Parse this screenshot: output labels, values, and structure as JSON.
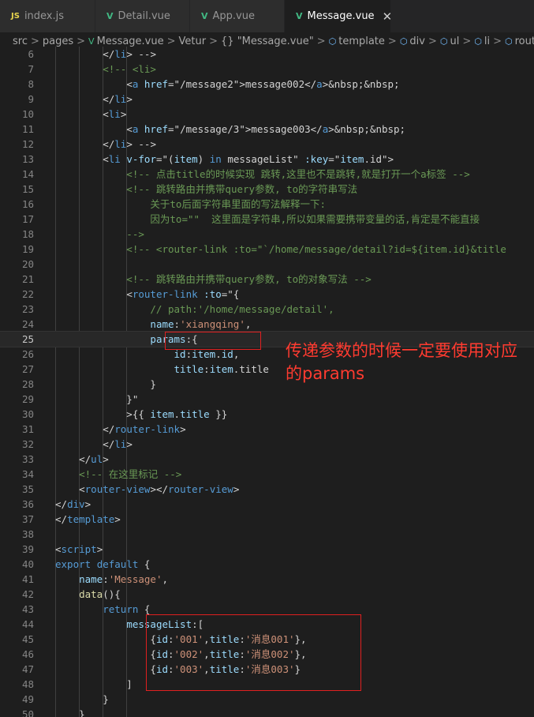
{
  "tabs": [
    {
      "icon": "JS",
      "label": "index.js",
      "active": false
    },
    {
      "icon": "V",
      "label": "Detail.vue",
      "active": false
    },
    {
      "icon": "V",
      "label": "App.vue",
      "active": false
    },
    {
      "icon": "V",
      "label": "Message.vue",
      "active": true,
      "close": "✕"
    }
  ],
  "breadcrumb": {
    "items": [
      "src",
      "pages",
      "Message.vue",
      "Vetur",
      "{} \"Message.vue\"",
      "template",
      "div",
      "ul",
      "li",
      "router-link"
    ],
    "separator": ">"
  },
  "editor": {
    "current_line": 25,
    "lines": [
      {
        "n": "6",
        "t": "            </li> -->"
      },
      {
        "n": "7",
        "t": "            <!-- <li>"
      },
      {
        "n": "8",
        "t": "                <a href=\"/message2\">message002</a>&nbsp;&nbsp;"
      },
      {
        "n": "9",
        "t": "            </li>"
      },
      {
        "n": "10",
        "t": "            <li>"
      },
      {
        "n": "11",
        "t": "                <a href=\"/message/3\">message003</a>&nbsp;&nbsp;"
      },
      {
        "n": "12",
        "t": "            </li> -->"
      },
      {
        "n": "13",
        "t": "            <li v-for=\"(item) in messageList\" :key=\"item.id\">"
      },
      {
        "n": "14",
        "t": "                <!-- 点击title的时候实现 跳转,这里也不是跳转,就是打开一个a标签 -->"
      },
      {
        "n": "15",
        "t": "                <!-- 跳转路由并携带query参数, to的字符串写法"
      },
      {
        "n": "16",
        "t": "                    关于to后面字符串里面的写法解释一下:"
      },
      {
        "n": "17",
        "t": "                    因为to=\"\"  这里面是字符串,所以如果需要携带变量的话,肯定是不能直接"
      },
      {
        "n": "18",
        "t": "                -->"
      },
      {
        "n": "19",
        "t": "                <!-- <router-link :to=\"`/home/message/detail?id=${item.id}&title"
      },
      {
        "n": "20",
        "t": ""
      },
      {
        "n": "21",
        "t": "                <!-- 跳转路由并携带query参数, to的对象写法 -->"
      },
      {
        "n": "22",
        "t": "                <router-link :to=\"{"
      },
      {
        "n": "23",
        "t": "                    // path:'/home/message/detail',"
      },
      {
        "n": "24",
        "t": "                    name:'xiangqing',"
      },
      {
        "n": "25",
        "t": "                    params:{"
      },
      {
        "n": "26",
        "t": "                        id:item.id,"
      },
      {
        "n": "27",
        "t": "                        title:item.title"
      },
      {
        "n": "28",
        "t": "                    }"
      },
      {
        "n": "29",
        "t": "                }\""
      },
      {
        "n": "30",
        "t": "                >{{ item.title }}"
      },
      {
        "n": "31",
        "t": "            </router-link>"
      },
      {
        "n": "32",
        "t": "            </li>"
      },
      {
        "n": "33",
        "t": "        </ul>"
      },
      {
        "n": "34",
        "t": "        <!-- 在这里标记 -->"
      },
      {
        "n": "35",
        "t": "        <router-view></router-view>"
      },
      {
        "n": "36",
        "t": "    </div>"
      },
      {
        "n": "37",
        "t": "</template>"
      },
      {
        "n": "38",
        "t": ""
      },
      {
        "n": "39",
        "t": "<script>"
      },
      {
        "n": "40",
        "t": "    export default {"
      },
      {
        "n": "41",
        "t": "        name:'Message',"
      },
      {
        "n": "42",
        "t": "        data(){"
      },
      {
        "n": "43",
        "t": "            return {"
      },
      {
        "n": "44",
        "t": "                messageList:["
      },
      {
        "n": "45",
        "t": "                    {id:'001',title:'消息001'},"
      },
      {
        "n": "46",
        "t": "                    {id:'002',title:'消息002'},"
      },
      {
        "n": "47",
        "t": "                    {id:'003',title:'消息003'}"
      },
      {
        "n": "48",
        "t": "                ]"
      },
      {
        "n": "49",
        "t": "            }"
      },
      {
        "n": "50",
        "t": "        }"
      }
    ]
  },
  "annotation": "传递参数的时候一定要使用对应的params",
  "colors": {
    "background": "#1e1e1e",
    "comment": "#6a9955",
    "tag": "#569cd6",
    "attribute": "#9cdcfe",
    "string": "#ce9178",
    "highlight_box": "#e02020",
    "annotation_text": "#ff3b30"
  }
}
